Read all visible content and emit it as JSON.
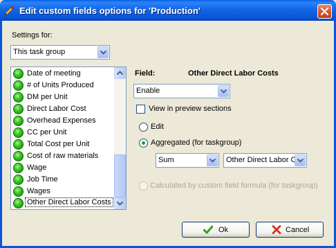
{
  "window": {
    "title": "Edit custom fields options for  'Production'"
  },
  "settings": {
    "label": "Settings for:",
    "value": "This task group"
  },
  "fields_list": {
    "items": [
      "Date of meeting",
      "# of Units Produced",
      "DM per Unit",
      "Direct Labor Cost",
      "Overhead Expenses",
      "CC per Unit",
      "Total Cost per Unit",
      "Cost of raw materials",
      "Wage",
      "Job Time",
      "Wages",
      "Other Direct Labor Costs"
    ],
    "selected_index": 11
  },
  "field_panel": {
    "field_label": "Field:",
    "field_name": "Other Direct Labor Costs",
    "state_value": "Enable",
    "preview_label": "View in preview sections",
    "edit_label": "Edit",
    "aggregated_label": "Aggregated (for taskgroup)",
    "aggregate_func": "Sum",
    "aggregate_field": "Other Direct Labor C",
    "calculated_label": "Calculated by custom field formula (for taskgroup)"
  },
  "buttons": {
    "ok": "Ok",
    "cancel": "Cancel"
  },
  "colors": {
    "title_bar": "#0a5fe8",
    "dialog_bg": "#ece9d8",
    "status_green": "#34c01c"
  }
}
